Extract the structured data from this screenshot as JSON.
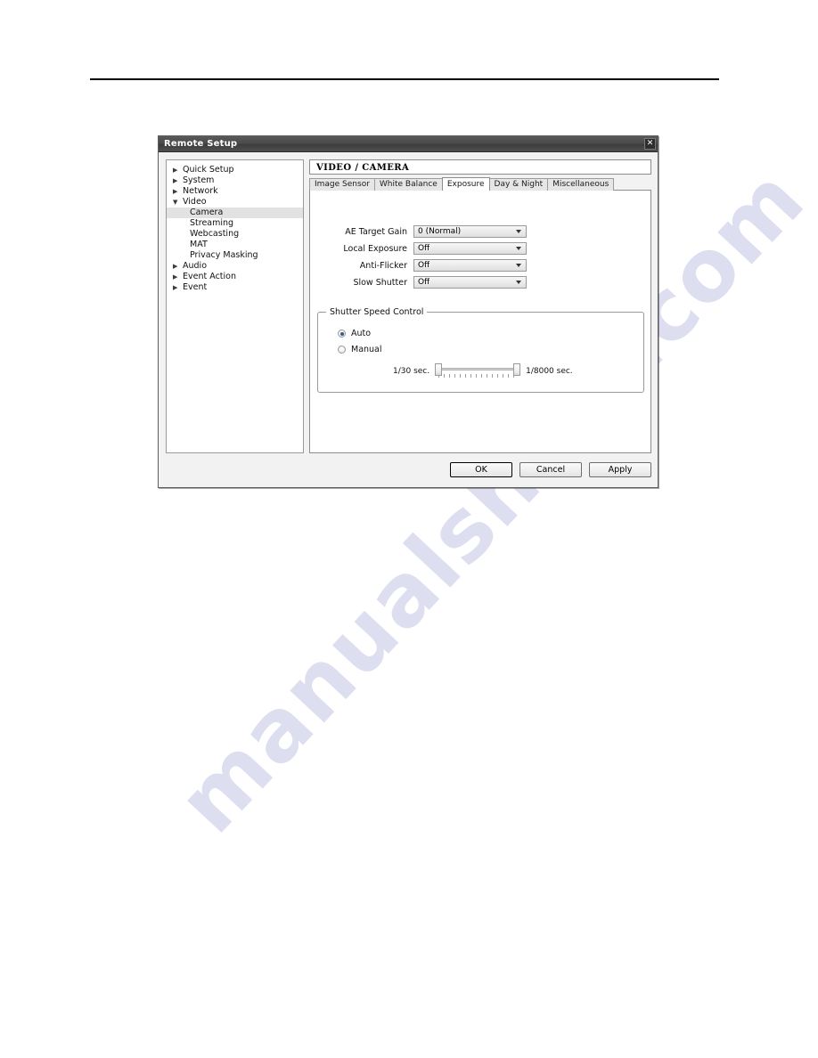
{
  "watermark": {
    "text": "manualshive.com"
  },
  "dialog": {
    "title": "Remote Setup",
    "close_label": "✕"
  },
  "nav_tree": {
    "items": [
      {
        "label": "Quick Setup",
        "level": 0,
        "state": "collapsed",
        "selected": false
      },
      {
        "label": "System",
        "level": 0,
        "state": "collapsed",
        "selected": false
      },
      {
        "label": "Network",
        "level": 0,
        "state": "collapsed",
        "selected": false
      },
      {
        "label": "Video",
        "level": 0,
        "state": "expanded",
        "selected": false
      },
      {
        "label": "Camera",
        "level": 1,
        "state": "leaf",
        "selected": true
      },
      {
        "label": "Streaming",
        "level": 1,
        "state": "leaf",
        "selected": false
      },
      {
        "label": "Webcasting",
        "level": 1,
        "state": "leaf",
        "selected": false
      },
      {
        "label": "MAT",
        "level": 1,
        "state": "leaf",
        "selected": false
      },
      {
        "label": "Privacy Masking",
        "level": 1,
        "state": "leaf",
        "selected": false
      },
      {
        "label": "Audio",
        "level": 0,
        "state": "collapsed",
        "selected": false
      },
      {
        "label": "Event Action",
        "level": 0,
        "state": "collapsed",
        "selected": false
      },
      {
        "label": "Event",
        "level": 0,
        "state": "collapsed",
        "selected": false
      }
    ]
  },
  "content": {
    "header": "VIDEO / CAMERA",
    "tabs": [
      {
        "label": "Image Sensor",
        "active": false
      },
      {
        "label": "White Balance",
        "active": false
      },
      {
        "label": "Exposure",
        "active": true
      },
      {
        "label": "Day & Night",
        "active": false
      },
      {
        "label": "Miscellaneous",
        "active": false
      }
    ],
    "fields": [
      {
        "label": "AE Target Gain",
        "value": "0 (Normal)"
      },
      {
        "label": "Local Exposure",
        "value": "Off"
      },
      {
        "label": "Anti-Flicker",
        "value": "Off"
      },
      {
        "label": "Slow Shutter",
        "value": "Off"
      }
    ],
    "shutter_group": {
      "title": "Shutter Speed Control",
      "options": [
        {
          "label": "Auto",
          "checked": true
        },
        {
          "label": "Manual",
          "checked": false
        }
      ],
      "slider": {
        "min_label": "1/30 sec.",
        "max_label": "1/8000 sec.",
        "low_position_pct": 0,
        "high_position_pct": 100
      }
    }
  },
  "buttons": {
    "ok": "OK",
    "cancel": "Cancel",
    "apply": "Apply"
  }
}
